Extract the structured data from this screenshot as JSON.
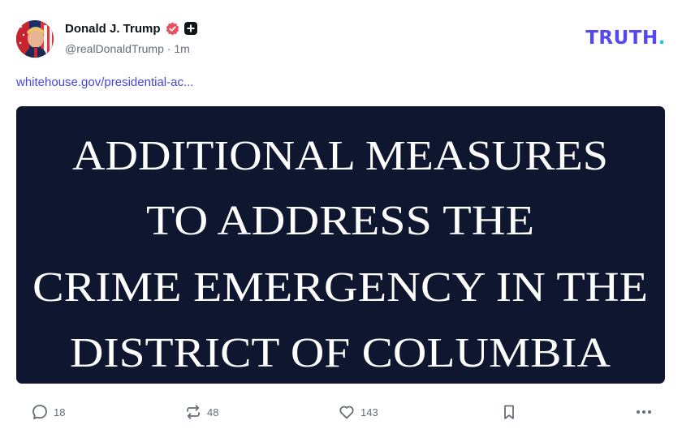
{
  "post": {
    "author": {
      "display_name": "Donald J. Trump",
      "handle": "@realDonaldTrump",
      "separator": "·",
      "time": "1m",
      "verified_icon": "verified-badge-icon",
      "plus_icon": "plus-badge-icon"
    },
    "brand": {
      "name": "TRUTH",
      "dot": "."
    },
    "link_text": "whitehouse.gov/presidential-ac...",
    "image_text": {
      "lines": [
        "ADDITIONAL MEASURES",
        "TO ADDRESS THE",
        "CRIME EMERGENCY IN THE",
        "DISTRICT OF COLUMBIA"
      ]
    },
    "actions": {
      "replies": "18",
      "retruths": "48",
      "likes": "143",
      "reply_icon": "reply-icon",
      "retruth_icon": "retruth-icon",
      "like_icon": "heart-icon",
      "bookmark_icon": "bookmark-icon",
      "more_icon": "more-icon"
    }
  },
  "colors": {
    "brand": "#5448ee",
    "brand_dot": "#1ec9e6",
    "link": "#4a45d6",
    "media_bg": "#0e1630",
    "verified": "#e8505b",
    "muted": "#656d78"
  }
}
